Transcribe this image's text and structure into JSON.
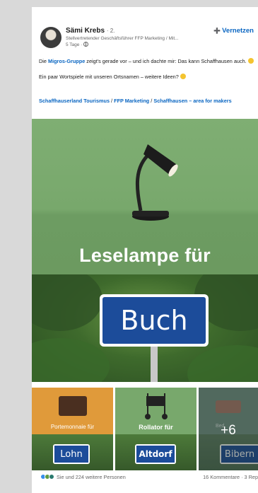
{
  "post": {
    "author_name": "Sämi Krebs",
    "degree": "· 2.",
    "headline": "Stellvertretender Geschäftsführer FFP Marketing / Mit...",
    "time": "5 Tage ·",
    "follow_label": "Vernetzen",
    "text_prefix": "Die ",
    "mention": "Migros-Gruppe",
    "text_suffix": " zeigt's gerade vor – und ich dachte mir: Das kann Schaffhausen auch.",
    "text_line2": "Ein paar Wortspiele mit unseren Ortsnamen – weitere Ideen?",
    "tags": [
      "Schaffhauserland Tourismus",
      "FFP Marketing",
      "Schaffhausen – area for makers"
    ],
    "tag_separator": " / "
  },
  "images": {
    "hero1_label": "Leselampe für",
    "hero2_sign": "Buch",
    "thumbs": [
      {
        "label": "Portemonnaie für",
        "sign": "Lohn"
      },
      {
        "label": "Rollator für",
        "sign": "Altdorf"
      },
      {
        "label": "Bed",
        "sign": "Bibern",
        "more": "+6"
      }
    ]
  },
  "footer": {
    "reactions_text": "Sie und 224 weitere Personen",
    "comments_text": "16 Kommentare · 3 Rep"
  },
  "colors": {
    "link": "#0a66c2",
    "sign_blue": "#1c4c9a",
    "hero_green": "#7fae73"
  },
  "icons": [
    "globe-icon",
    "follow-icon",
    "like-icon",
    "celebrate-icon",
    "support-icon"
  ]
}
